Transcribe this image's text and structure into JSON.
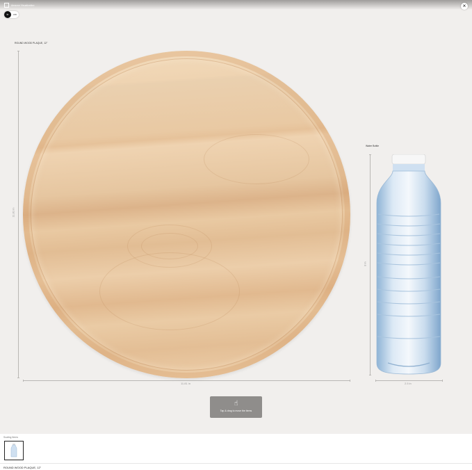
{
  "header": {
    "logo_text": "Amazon Visualization",
    "unit_toggle": {
      "selected": "in",
      "other": "cm"
    },
    "close_symbol": "×"
  },
  "scene": {
    "plaque": {
      "label": "ROUND WOOD PLAQUE, 12\"",
      "height_dim": "11.81 in",
      "width_dim": "11.81 in"
    },
    "bottle": {
      "label": "Water Bottle",
      "height_dim": "8 in",
      "width_dim": "2.5 in"
    }
  },
  "hint": {
    "icon": "hand-pointer-icon",
    "icon_glyph": "☝",
    "text": "Tap & drag to move the items"
  },
  "bottom": {
    "section_label": "Scaling Items",
    "caption": "ROUND WOOD PLAQUE, 12\""
  }
}
